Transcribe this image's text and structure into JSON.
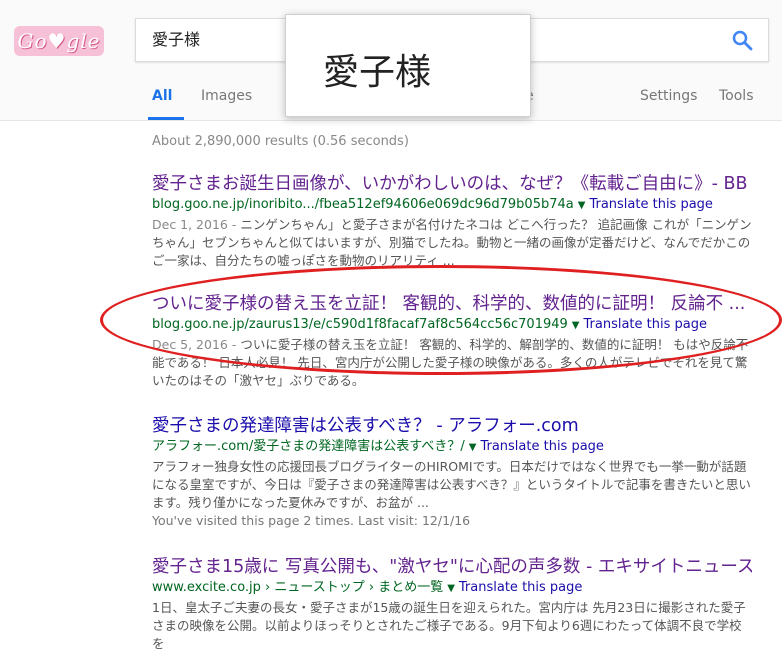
{
  "logo": {
    "text": "Go♥gle"
  },
  "search": {
    "query": "愛子様"
  },
  "tabs": [
    {
      "label": "All"
    },
    {
      "label": "Images"
    },
    {
      "label": "e"
    },
    {
      "label": "Settings"
    },
    {
      "label": "Tools"
    }
  ],
  "overlay": {
    "text": "愛子様"
  },
  "stats": {
    "text": "About 2,890,000 results (0.56 seconds)"
  },
  "results": [
    {
      "title": "愛子さまお誕生日画像が、いかがわしいのは、なぜ？《転載ご自由に》- BB ...",
      "url": "blog.goo.ne.jp/inoribito.../fbea512ef94606e069dc96d79b05b74a",
      "translate": "Translate this page",
      "date": "Dec 1, 2016 - ",
      "snippet": "ニンゲンちゃん」と愛子さまが名付けたネコは どこへ行った？ 追記画像 これが「ニンゲンちゃん」セブンちゃんと似てはいますが、別猫でしたね。動物と一緒の画像が定番だけど、なんでだかこのご一家は、自分たちの嘘っぽさを動物のリアリティ ..."
    },
    {
      "title": "ついに愛子様の替え玉を立証！ 客観的、科学的、数値的に証明！ 反論不 ...",
      "url": "blog.goo.ne.jp/zaurus13/e/c590d1f8facaf7af8c564cc56c701949",
      "translate": "Translate this page",
      "date": "Dec 5, 2016 - ",
      "snippet": "ついに愛子様の替え玉を立証！ 客観的、科学的、解剖学的、数値的に証明！ もはや反論不能である！ 日本人必見！ 先日、宮内庁が公開した愛子様の映像がある。多くの人がテレビでそれを見て驚いたのはその「激ヤセ」ぶりである。"
    },
    {
      "title": "愛子さまの発達障害は公表すべき？ - アラフォー.com",
      "url": "アラフォー.com/愛子さまの発達障害は公表すべき？/",
      "translate": "Translate this page",
      "snippet": "アラフォー独身女性の応援団長ブログライターのHIROMIです。日本だけではなく世界でも一挙一動が話題になる皇室ですが、今日は『愛子さまの発達障害は公表すべき？』というタイトルで記事を書きたいと思います。残り僅かになった夏休みですが、お盆が ...",
      "visited": "You've visited this page 2 times. Last visit: 12/1/16"
    },
    {
      "title": "愛子さま15歳に 写真公開も、\"激ヤセ\"に心配の声多数 - エキサイトニュース",
      "url": "www.excite.co.jp › ニューストップ › まとめ一覧",
      "translate": "Translate this page",
      "snippet": "1日、皇太子ご夫妻の長女・愛子さまが15歳の誕生日を迎えられた。宮内庁は 先月23日に撮影された愛子さまの映像を公開。以前よりほっそりとされたご様子である。9月下旬より6週にわたって体調不良で学校を"
    }
  ],
  "colors": {
    "visited_link": "#63238f",
    "link": "#1a0dab",
    "url_green": "#006621",
    "annotation_red": "#e02020",
    "tab_active": "#1a73e8"
  }
}
